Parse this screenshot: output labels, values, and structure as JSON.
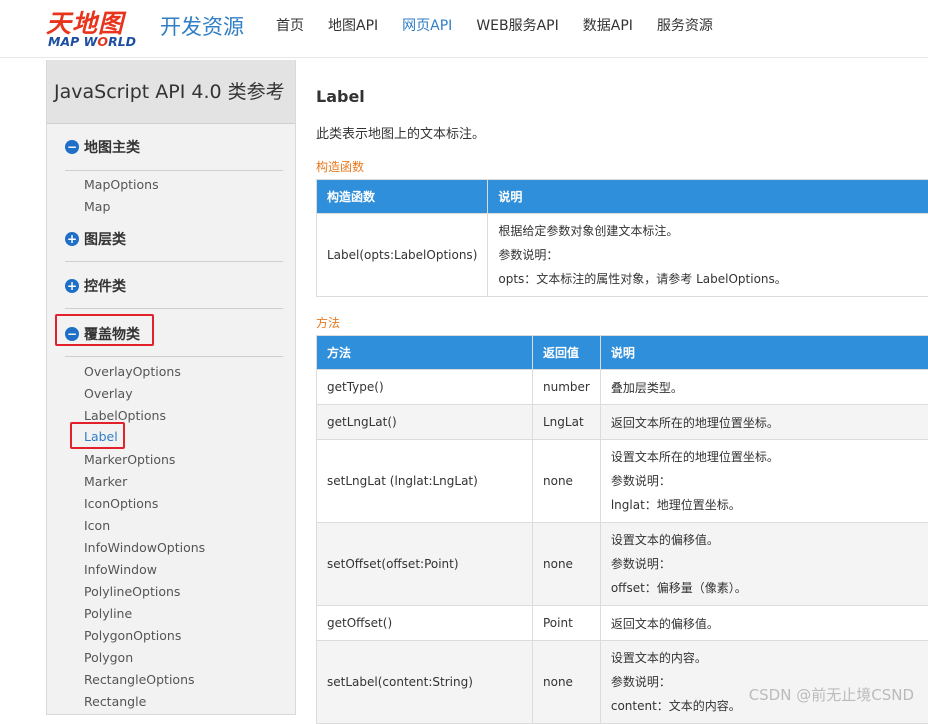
{
  "header": {
    "logo_cn": "天地图",
    "logo_en_a": "MAP W",
    "logo_en_o": "O",
    "logo_en_b": "RLD",
    "site_title": "开发资源",
    "nav": [
      "首页",
      "地图API",
      "网页API",
      "WEB服务API",
      "数据API",
      "服务资源"
    ],
    "active_nav": "网页API"
  },
  "sidebar": {
    "title": "JavaScript API 4.0 类参考",
    "groups": [
      {
        "label": "地图主类",
        "expanded": true,
        "items": [
          "MapOptions",
          "Map"
        ]
      },
      {
        "label": "图层类",
        "expanded": false,
        "items": []
      },
      {
        "label": "控件类",
        "expanded": false,
        "items": []
      },
      {
        "label": "覆盖物类",
        "expanded": true,
        "highlighted": true,
        "items": [
          "OverlayOptions",
          "Overlay",
          "LabelOptions",
          "Label",
          "MarkerOptions",
          "Marker",
          "IconOptions",
          "Icon",
          "InfoWindowOptions",
          "InfoWindow",
          "PolylineOptions",
          "Polyline",
          "PolygonOptions",
          "Polygon",
          "RectangleOptions",
          "Rectangle"
        ]
      }
    ],
    "active_item": "Label"
  },
  "content": {
    "title": "Label",
    "description": "此类表示地图上的文本标注。",
    "constructor_section": "构造函数",
    "constructor_table": {
      "headers": [
        "构造函数",
        "说明"
      ],
      "rows": [
        {
          "name": "Label(opts:LabelOptions)",
          "desc": [
            "根据给定参数对象创建文本标注。",
            "参数说明：",
            "opts：文本标注的属性对象，请参考 LabelOptions。"
          ]
        }
      ]
    },
    "method_section": "方法",
    "method_table": {
      "headers": [
        "方法",
        "返回值",
        "说明"
      ],
      "rows": [
        {
          "name": "getType()",
          "ret": "number",
          "desc": [
            "叠加层类型。"
          ]
        },
        {
          "name": "getLngLat()",
          "ret": "LngLat",
          "desc": [
            "返回文本所在的地理位置坐标。"
          ]
        },
        {
          "name": "setLngLat (lnglat:LngLat)",
          "ret": "none",
          "desc": [
            "设置文本所在的地理位置坐标。",
            "参数说明：",
            "lnglat：地理位置坐标。"
          ]
        },
        {
          "name": "setOffset(offset:Point)",
          "ret": "none",
          "desc": [
            "设置文本的偏移值。",
            "参数说明：",
            "offset：偏移量（像素）。"
          ]
        },
        {
          "name": "getOffset()",
          "ret": "Point",
          "desc": [
            "返回文本的偏移值。"
          ]
        },
        {
          "name": "setLabel(content:String)",
          "ret": "none",
          "desc": [
            "设置文本的内容。",
            "参数说明：",
            "content：文本的内容。"
          ]
        }
      ]
    }
  },
  "watermark": "CSDN @前无止境CSND",
  "colors": {
    "accent": "#2f7ec6",
    "table_header": "#2f8fdb",
    "section": "#e8791e",
    "highlight_box": "#e3212d"
  }
}
